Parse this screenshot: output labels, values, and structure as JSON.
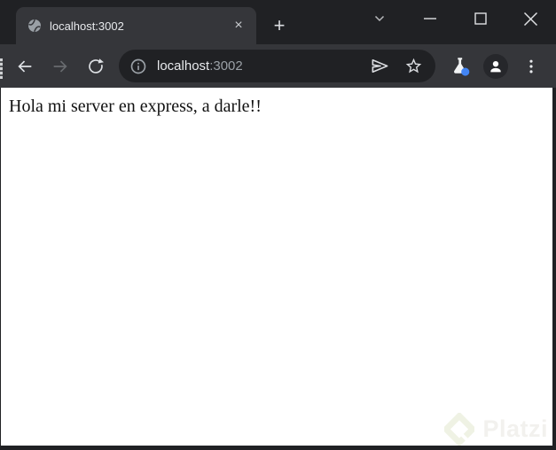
{
  "tab": {
    "title": "localhost:3002",
    "close_glyph": "×",
    "new_tab_glyph": "+"
  },
  "address_bar": {
    "host": "localhost",
    "port": ":3002"
  },
  "page": {
    "text": "Hola mi server en express, a darle!!"
  },
  "watermark": {
    "brand": "Platzi"
  },
  "colors": {
    "frame": "#202124",
    "toolbar": "#35363a",
    "omnibox_bg": "#202124",
    "text_primary": "#e8eaed",
    "text_secondary": "#9aa0a6",
    "disabled_icon": "#686b6f",
    "accent_blue": "#4285f4",
    "page_background": "#ffffff",
    "watermark_tint": "#f1f2ea"
  }
}
